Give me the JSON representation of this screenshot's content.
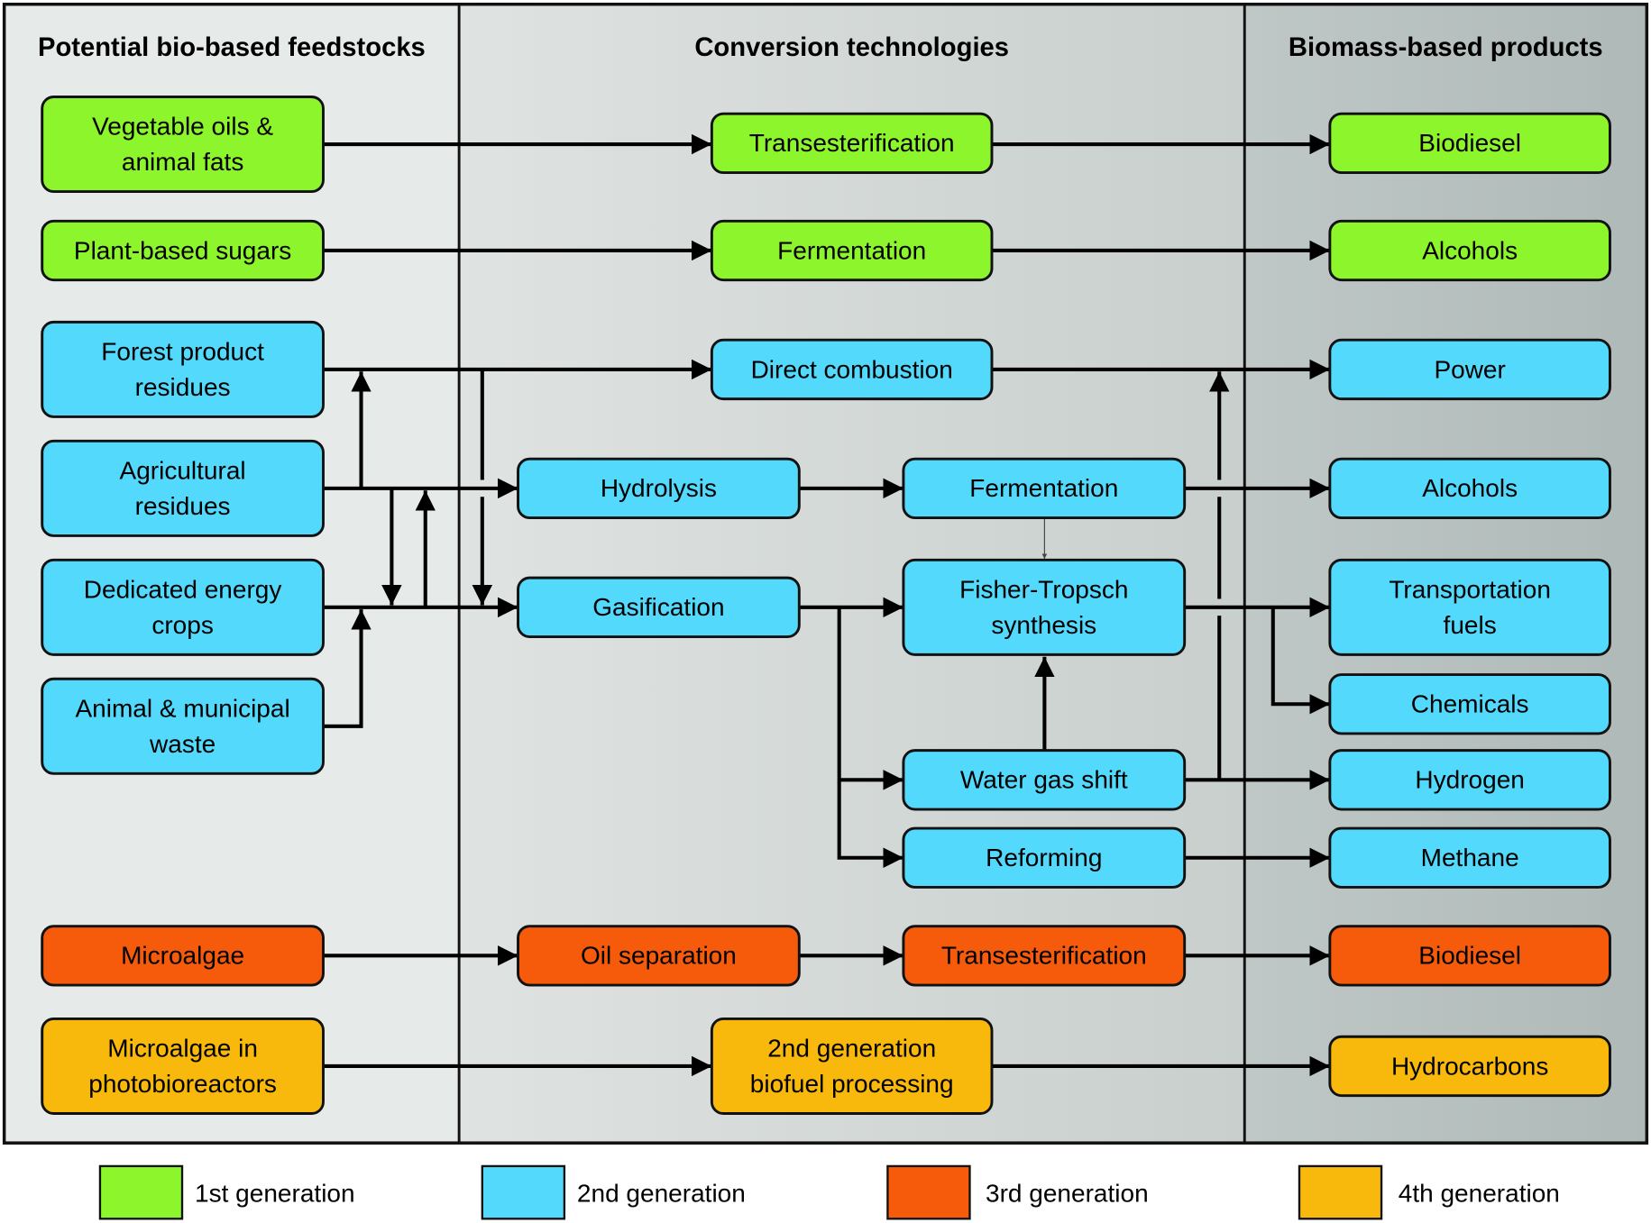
{
  "colors": {
    "gen1": "#8cf52b",
    "gen2": "#52d9fb",
    "gen3": "#f65a0b",
    "gen4": "#f8b90c",
    "col_left_bg": "#e6eae8",
    "col_mid_bg": "#d2d8d6",
    "col_right_bg": "#b8c2c0"
  },
  "columns": [
    {
      "title": "Potential bio-based feedstocks"
    },
    {
      "title": "Conversion technologies"
    },
    {
      "title": "Biomass-based products"
    }
  ],
  "nodes": {
    "veg_oils": {
      "lines": [
        "Vegetable oils &",
        "animal fats"
      ],
      "gen": "gen1"
    },
    "plant_sugars": {
      "lines": [
        "Plant-based sugars"
      ],
      "gen": "gen1"
    },
    "forest": {
      "lines": [
        "Forest product",
        "residues"
      ],
      "gen": "gen2"
    },
    "agri": {
      "lines": [
        "Agricultural",
        "residues"
      ],
      "gen": "gen2"
    },
    "dedicated": {
      "lines": [
        "Dedicated energy",
        "crops"
      ],
      "gen": "gen2"
    },
    "animal": {
      "lines": [
        "Animal & municipal",
        "waste"
      ],
      "gen": "gen2"
    },
    "microalgae": {
      "lines": [
        "Microalgae"
      ],
      "gen": "gen3"
    },
    "microalgae_pbr": {
      "lines": [
        "Microalgae in",
        "photobioreactors"
      ],
      "gen": "gen4"
    },
    "transest1": {
      "lines": [
        "Transesterification"
      ],
      "gen": "gen1"
    },
    "ferment1": {
      "lines": [
        "Fermentation"
      ],
      "gen": "gen1"
    },
    "combustion": {
      "lines": [
        "Direct combustion"
      ],
      "gen": "gen2"
    },
    "hydrolysis": {
      "lines": [
        "Hydrolysis"
      ],
      "gen": "gen2"
    },
    "ferment2": {
      "lines": [
        "Fermentation"
      ],
      "gen": "gen2"
    },
    "gasification": {
      "lines": [
        "Gasification"
      ],
      "gen": "gen2"
    },
    "fischer": {
      "lines": [
        "Fisher-Tropsch",
        "synthesis"
      ],
      "gen": "gen2"
    },
    "wgs": {
      "lines": [
        "Water gas shift"
      ],
      "gen": "gen2"
    },
    "reforming": {
      "lines": [
        "Reforming"
      ],
      "gen": "gen2"
    },
    "oil_sep": {
      "lines": [
        "Oil separation"
      ],
      "gen": "gen3"
    },
    "transest2": {
      "lines": [
        "Transesterification"
      ],
      "gen": "gen3"
    },
    "gen2proc": {
      "lines": [
        "2nd generation",
        "biofuel processing"
      ],
      "gen": "gen4"
    },
    "biodiesel1": {
      "lines": [
        "Biodiesel"
      ],
      "gen": "gen1"
    },
    "alcohols1": {
      "lines": [
        "Alcohols"
      ],
      "gen": "gen1"
    },
    "power": {
      "lines": [
        "Power"
      ],
      "gen": "gen2"
    },
    "alcohols2": {
      "lines": [
        "Alcohols"
      ],
      "gen": "gen2"
    },
    "transport": {
      "lines": [
        "Transportation",
        "fuels"
      ],
      "gen": "gen2"
    },
    "chemicals": {
      "lines": [
        "Chemicals"
      ],
      "gen": "gen2"
    },
    "hydrogen": {
      "lines": [
        "Hydrogen"
      ],
      "gen": "gen2"
    },
    "methane": {
      "lines": [
        "Methane"
      ],
      "gen": "gen2"
    },
    "biodiesel2": {
      "lines": [
        "Biodiesel"
      ],
      "gen": "gen3"
    },
    "hydrocarbons": {
      "lines": [
        "Hydrocarbons"
      ],
      "gen": "gen4"
    }
  },
  "legend": [
    {
      "label": "1st generation",
      "gen": "gen1"
    },
    {
      "label": "2nd generation",
      "gen": "gen2"
    },
    {
      "label": "3rd generation",
      "gen": "gen3"
    },
    {
      "label": "4th generation",
      "gen": "gen4"
    }
  ]
}
